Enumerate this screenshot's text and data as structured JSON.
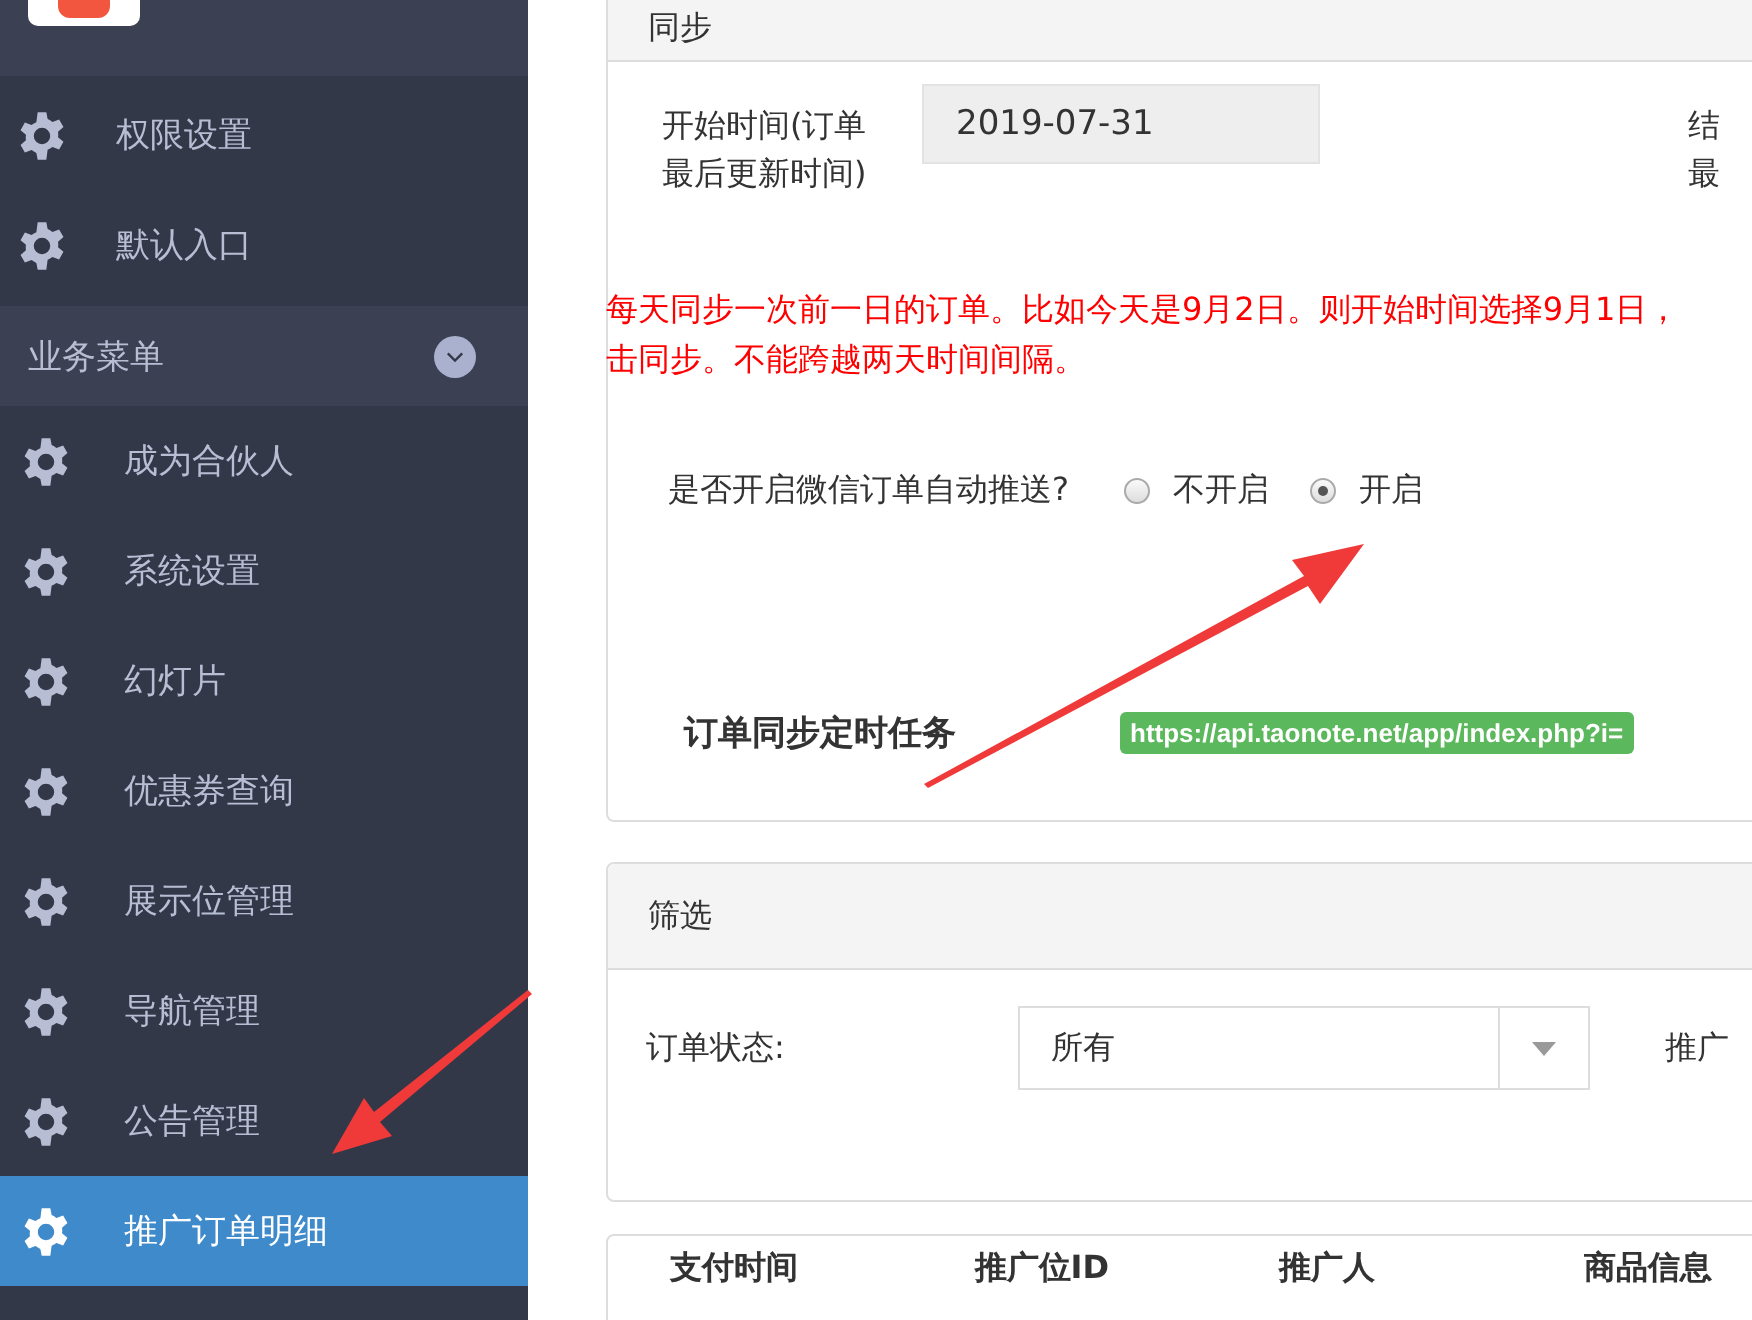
{
  "sidebar": {
    "top_items": [
      {
        "label": "权限设置",
        "selected": false
      },
      {
        "label": "默认入口",
        "selected": false
      }
    ],
    "section": {
      "label": "业务菜单",
      "expanded": true
    },
    "section_items": [
      {
        "label": "成为合伙人",
        "selected": false
      },
      {
        "label": "系统设置",
        "selected": false
      },
      {
        "label": "幻灯片",
        "selected": false
      },
      {
        "label": "优惠券查询",
        "selected": false
      },
      {
        "label": "展示位管理",
        "selected": false
      },
      {
        "label": "导航管理",
        "selected": false
      },
      {
        "label": "公告管理",
        "selected": false
      },
      {
        "label": "推广订单明细",
        "selected": true
      }
    ]
  },
  "sync_panel": {
    "title": "同步",
    "start_label": "开始时间(订单最后更新时间)",
    "start_value": "2019-07-31",
    "end_label_lines": [
      "结",
      "最"
    ],
    "notice_lines": [
      "每天同步一次前一日的订单。比如今天是9月2日。则开始时间选择9月1日，",
      "击同步。不能跨越两天时间间隔。"
    ],
    "push_label": "是否开启微信订单自动推送?",
    "push_options": [
      {
        "label": "不开启",
        "selected": false
      },
      {
        "label": "开启",
        "selected": true
      }
    ],
    "task_label": "订单同步定时任务",
    "task_url": "https://api.taonote.net/app/index.php?i="
  },
  "filter_panel": {
    "title": "筛选",
    "status_label": "订单状态:",
    "status_value": "所有",
    "next_label": "推广"
  },
  "table": {
    "columns": [
      "支付时间",
      "推广位ID",
      "推广人",
      "商品信息"
    ]
  }
}
